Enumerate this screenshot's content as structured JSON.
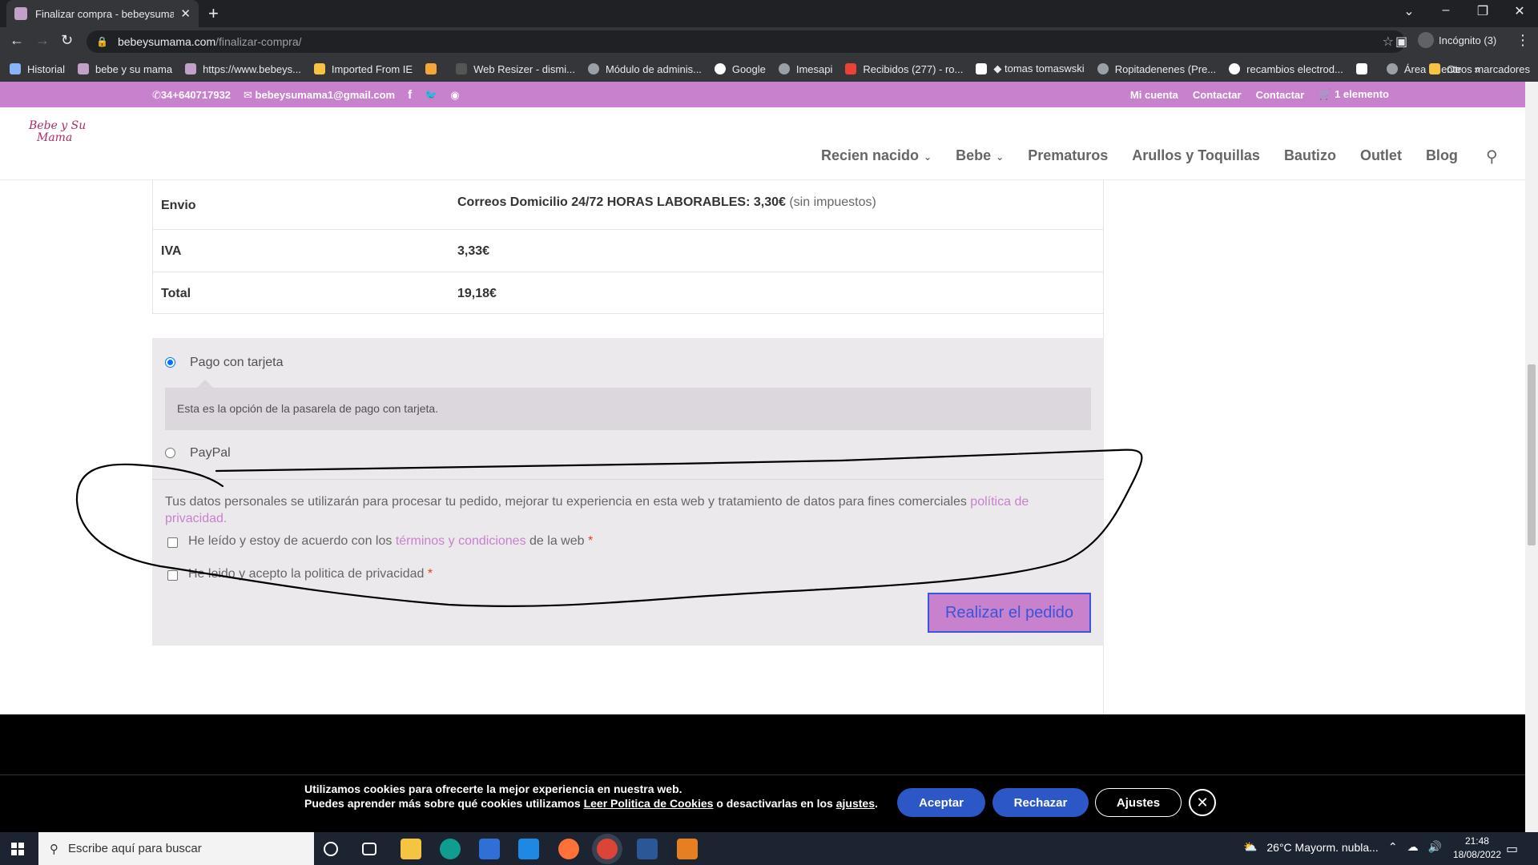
{
  "browser": {
    "tab_title": "Finalizar compra - bebeysumama.com",
    "url_domain": "bebeysumama.com",
    "url_path": "/finalizar-compra/",
    "profile_label": "Incógnito (3)",
    "bookmarks": [
      "Historial",
      "bebe y su mama",
      "https://www.bebeys...",
      "Imported From IE",
      "",
      "Web Resizer - dismi...",
      "Módulo de adminis...",
      "Google",
      "Imesapi",
      "Recibidos (277) - ro...",
      "◆ tomas tomaswski",
      "Ropitadenenes (Pre...",
      "recambios electrod...",
      "",
      "Área Cliente"
    ],
    "other_bookmarks": "Otros marcadores"
  },
  "topbar": {
    "phone": "34+640717932",
    "email": "bebeysumama1@gmail.com",
    "links": [
      "Mi cuenta",
      "Contactar",
      "Contactar"
    ],
    "cart": "1 elemento"
  },
  "header": {
    "logo_line1": "Bebe y Su",
    "logo_line2": "Mama",
    "nav": [
      "Recien nacido",
      "Bebe",
      "Prematuros",
      "Arullos y Toquillas",
      "Bautizo",
      "Outlet",
      "Blog"
    ]
  },
  "order": {
    "rows": [
      {
        "label": "Envio",
        "value": "Correos Domicilio 24/72 HORAS LABORABLES: 3,30€",
        "note": "(sin impuestos)"
      },
      {
        "label": "IVA",
        "value": "3,33€"
      },
      {
        "label": "Total",
        "value": "19,18€"
      }
    ]
  },
  "payment": {
    "card_label": "Pago con tarjeta",
    "card_desc": "Esta es la opción de la pasarela de pago con tarjeta.",
    "paypal_label": "PayPal",
    "privacy_text": "Tus datos personales se utilizarán para procesar tu pedido, mejorar tu experiencia en esta web y tratamiento de datos para fines comerciales",
    "privacy_link": "política de privacidad.",
    "terms_prefix": "He leído y estoy de acuerdo con los",
    "terms_link": "términos y condiciones",
    "terms_suffix": "de la web",
    "privacy_accept": "He leido y acepto la politica de privacidad",
    "required_mark": "*",
    "place_order": "Realizar el pedido"
  },
  "cookies": {
    "line1": "Utilizamos cookies para ofrecerte la mejor experiencia en nuestra web.",
    "line2_a": "Puedes aprender más sobre qué cookies utilizamos",
    "line2_link": "Leer Politica de Cookies",
    "line2_b": "o desactivarlas en los",
    "line2_link2": "ajustes",
    "line2_end": ".",
    "accept": "Aceptar",
    "reject": "Rechazar",
    "settings": "Ajustes"
  },
  "taskbar": {
    "search_placeholder": "Escribe aquí para buscar",
    "weather": "26°C  Mayorm. nubla...",
    "time": "21:48",
    "date": "18/08/2022"
  },
  "colors": {
    "brand": "#c881cc",
    "cookie_btn": "#2b58c6",
    "annotation": "#000000"
  }
}
